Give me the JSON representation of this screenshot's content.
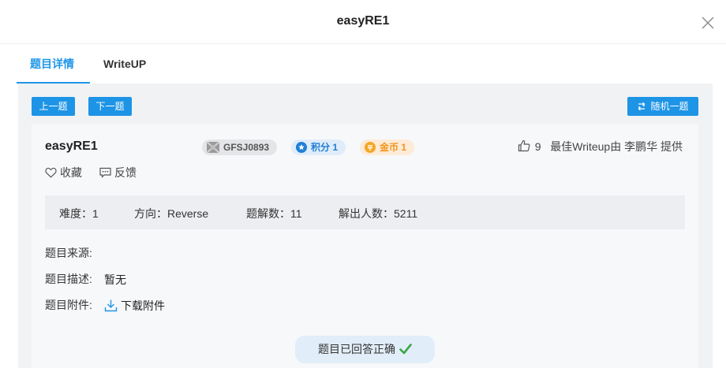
{
  "dialog": {
    "title": "easyRE1",
    "close_icon": "close-icon"
  },
  "tabs": [
    {
      "label": "题目详情",
      "active": true
    },
    {
      "label": "WriteUP",
      "active": false
    }
  ],
  "toolbar": {
    "prev_label": "上一题",
    "next_label": "下一题",
    "random_label": "随机一题",
    "random_icon": "shuffle-icon"
  },
  "challenge": {
    "name": "easyRE1",
    "id_badge": "GFSJ0893",
    "score_badge": "积分 1",
    "coin_badge": "金币 1",
    "likes": "9",
    "best_writeup": "最佳Writeup由 李鹏华 提供",
    "favorite_label": "收藏",
    "feedback_label": "反馈"
  },
  "stats": {
    "difficulty": "难度：1",
    "direction": "方向：Reverse",
    "solutions": "题解数：11",
    "solvers": "解出人数：5211"
  },
  "details": {
    "source_label": "题目来源:",
    "source_value": "",
    "desc_label": "题目描述:",
    "desc_value": "暂无",
    "attach_label": "题目附件:",
    "attach_link": "下载附件"
  },
  "status": {
    "solved_text": "题目已回答正确"
  },
  "colors": {
    "accent": "#1f96e8",
    "button": "#1d94e6",
    "score": "#1f7fd6",
    "coin": "#f0961d",
    "success": "#3aa845"
  }
}
